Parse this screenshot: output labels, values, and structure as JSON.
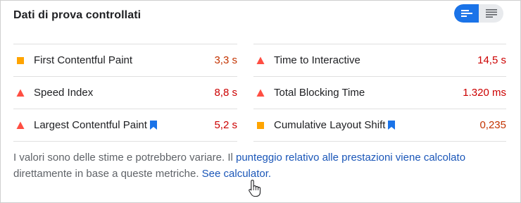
{
  "header": {
    "title": "Dati di prova controllati",
    "toggle": {
      "options": [
        {
          "icon": "bar-list-view-icon",
          "active": true
        },
        {
          "icon": "detailed-list-view-icon",
          "active": false
        }
      ],
      "accent": "#1a73e8"
    }
  },
  "metrics": {
    "left": [
      {
        "label": "First Contentful Paint",
        "value": "3,3 s",
        "status": "average",
        "icon": "square-icon",
        "color": "#c33300",
        "bookmark": false
      },
      {
        "label": "Speed Index",
        "value": "8,8 s",
        "status": "fail",
        "icon": "triangle-icon",
        "color": "#cc0000",
        "bookmark": false
      },
      {
        "label": "Largest Contentful Paint",
        "value": "5,2 s",
        "status": "fail",
        "icon": "triangle-icon",
        "color": "#cc0000",
        "bookmark": true
      }
    ],
    "right": [
      {
        "label": "Time to Interactive",
        "value": "14,5 s",
        "status": "fail",
        "icon": "triangle-icon",
        "color": "#cc0000",
        "bookmark": false
      },
      {
        "label": "Total Blocking Time",
        "value": "1.320 ms",
        "status": "fail",
        "icon": "triangle-icon",
        "color": "#cc0000",
        "bookmark": false
      },
      {
        "label": "Cumulative Layout Shift",
        "value": "0,235",
        "status": "average",
        "icon": "square-icon",
        "color": "#c33300",
        "bookmark": true
      }
    ],
    "colors": {
      "fail_icon": "#ff4e42",
      "average_icon": "#ffa400",
      "bookmark": "#1a73e8"
    }
  },
  "footer": {
    "text_before": "I valori sono delle stime e potrebbero variare. Il ",
    "link_score": "punteggio relativo alle prestazioni viene calcolato",
    "text_middle": "direttamente in base a queste metriche. ",
    "link_calculator": "See calculator."
  }
}
